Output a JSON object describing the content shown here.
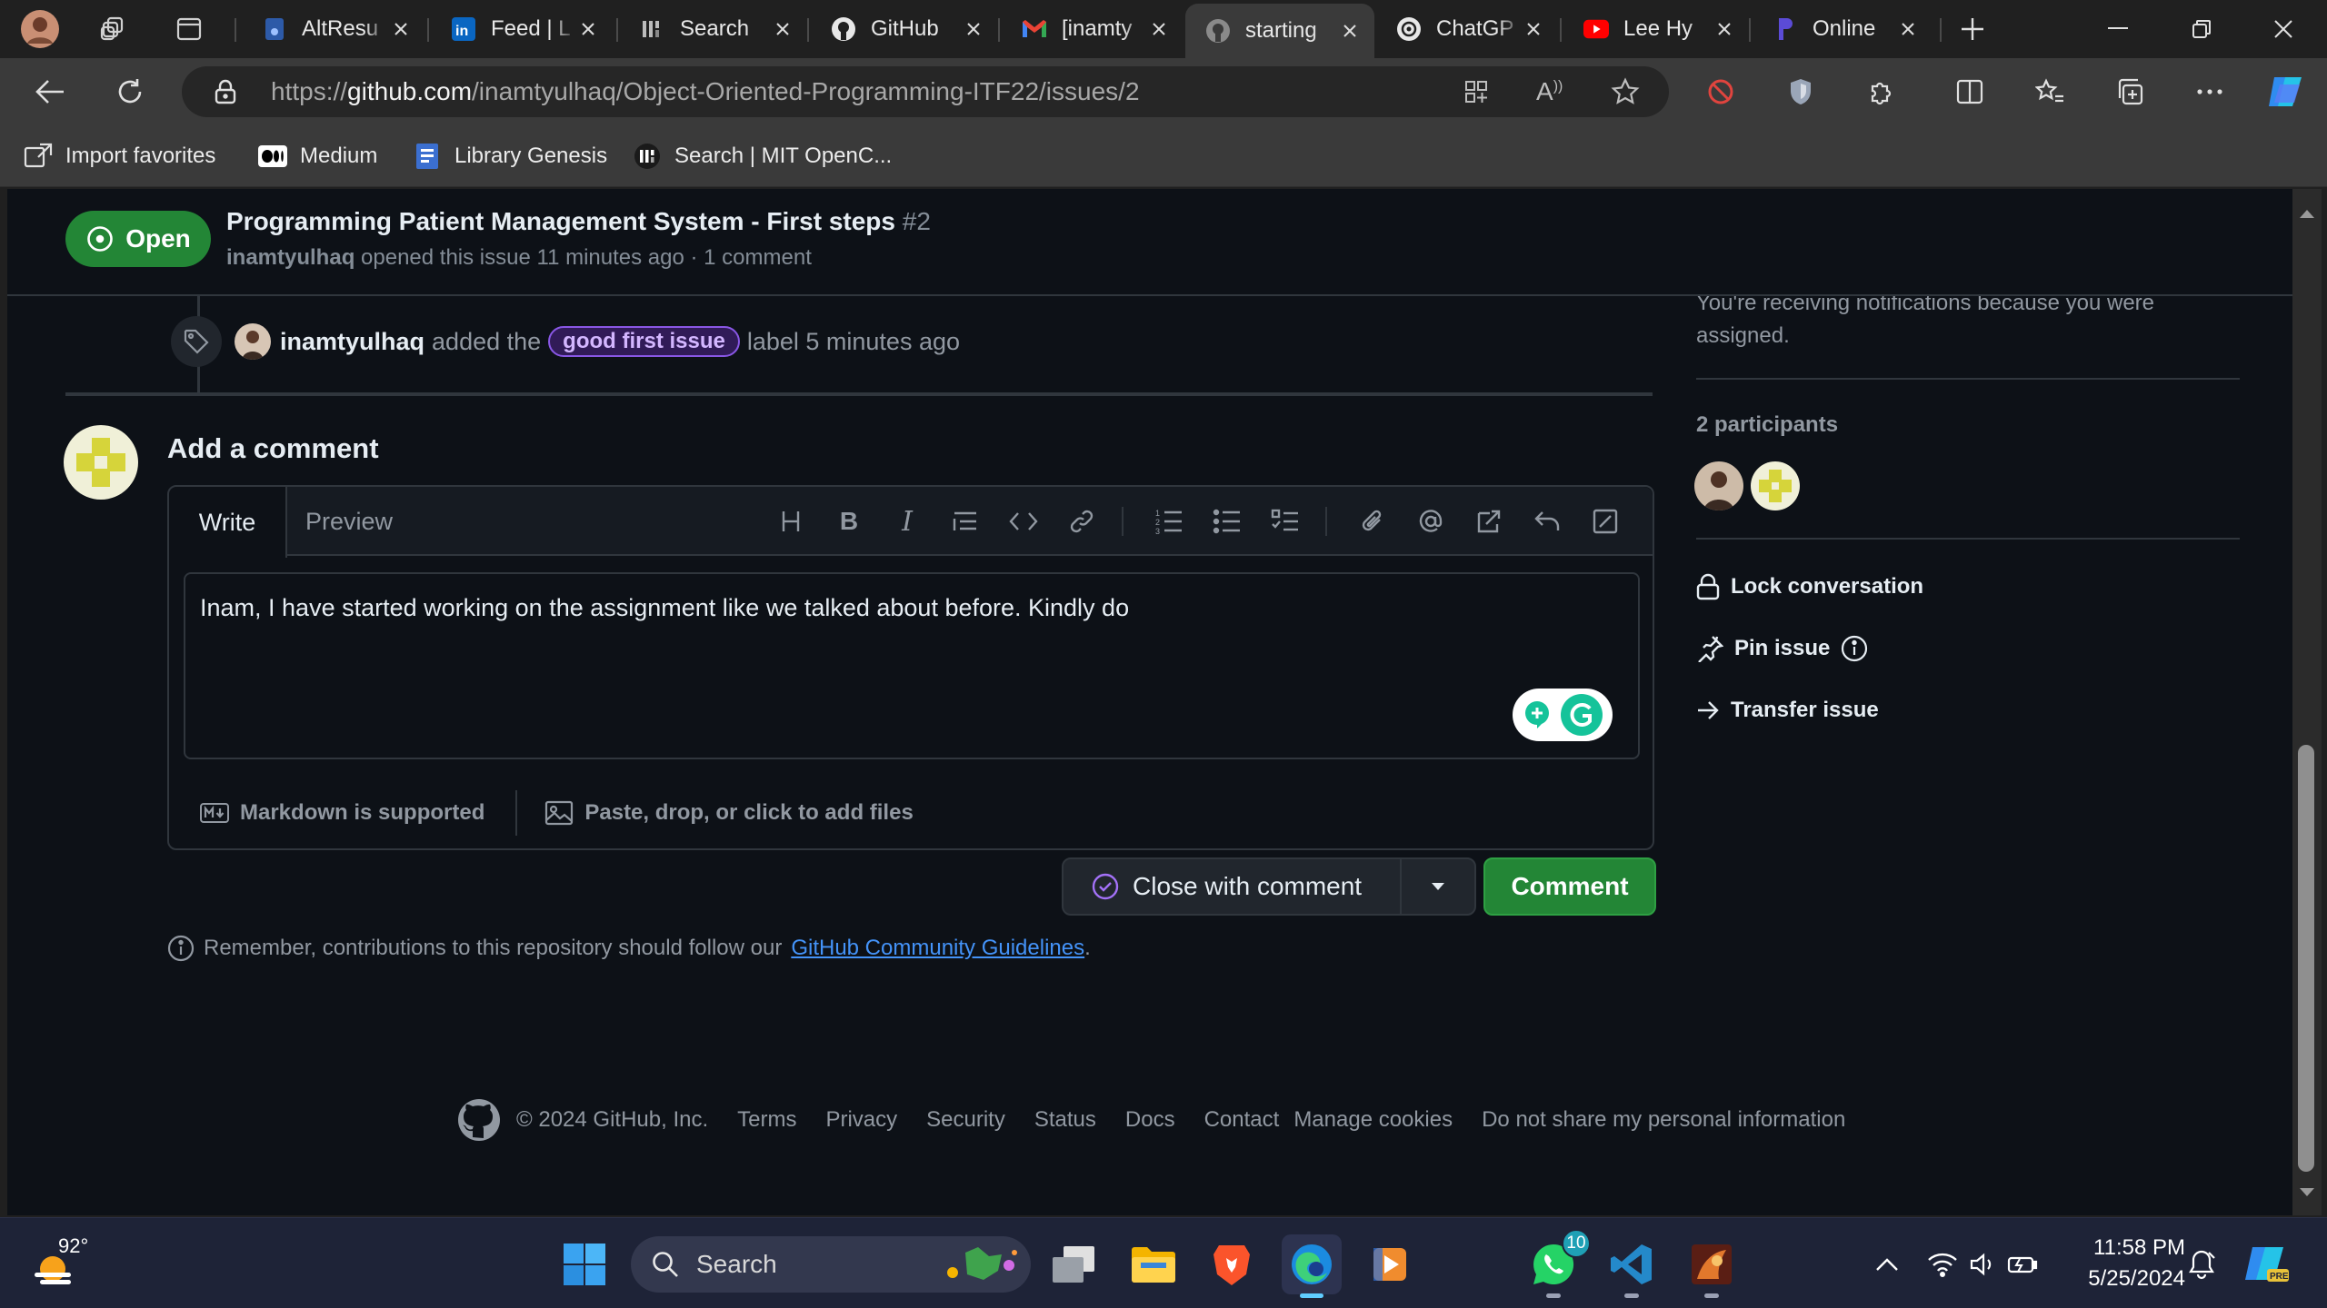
{
  "browser": {
    "tabs": [
      {
        "title": "AltResu"
      },
      {
        "title": "Feed | L"
      },
      {
        "title": "Search"
      },
      {
        "title": "GitHub"
      },
      {
        "title": "[inamty"
      },
      {
        "title": "starting"
      },
      {
        "title": "ChatGP"
      },
      {
        "title": "Lee Hy"
      },
      {
        "title": "Online"
      }
    ],
    "url_prefix": "https://",
    "url_domain": "github.com",
    "url_path": "/inamtyulhaq/Object-Oriented-Programming-ITF22/issues/2",
    "favorites": [
      {
        "label": "Import favorites"
      },
      {
        "label": "Medium"
      },
      {
        "label": "Library Genesis"
      },
      {
        "label": "Search | MIT OpenC..."
      }
    ]
  },
  "issue": {
    "state": "Open",
    "title": "Programming Patient Management System - First steps",
    "number": "#2",
    "author": "inamtyulhaq",
    "meta": "opened this issue 11 minutes ago · 1 comment"
  },
  "timeline": {
    "label_event": {
      "actor": "inamtyulhaq",
      "prefix": "added the",
      "label": "good first issue",
      "suffix": "label 5 minutes ago",
      "label_color": "#8957e5"
    }
  },
  "composer": {
    "heading": "Add a comment",
    "tabs": [
      "Write",
      "Preview"
    ],
    "text": "Inam, I have started working on the assignment like we talked about before. Kindly do",
    "markdown_note": "Markdown is supported",
    "attach_note": "Paste, drop, or click to add files",
    "close_label": "Close with comment",
    "comment_label": "Comment",
    "remember_prefix": "Remember, contributions to this repository should follow our",
    "remember_link": "GitHub Community Guidelines",
    "remember_suffix": "."
  },
  "sidebar": {
    "notification": "You're receiving notifications because you were assigned.",
    "participants_label": "2 participants",
    "actions": [
      {
        "label": "Lock conversation"
      },
      {
        "label": "Pin issue"
      },
      {
        "label": "Transfer issue"
      }
    ]
  },
  "footer": {
    "copyright": "© 2024 GitHub, Inc.",
    "links": [
      "Terms",
      "Privacy",
      "Security",
      "Status",
      "Docs",
      "Contact",
      "Manage cookies",
      "Do not share my personal information"
    ]
  },
  "taskbar": {
    "weather": "92°",
    "search_placeholder": "Search",
    "whatsapp_badge": "10",
    "time": "11:58 PM",
    "date": "5/25/2024"
  },
  "colors": {
    "accent_green": "#238636",
    "link_blue": "#4493f8",
    "page_bg": "#0d1117"
  }
}
